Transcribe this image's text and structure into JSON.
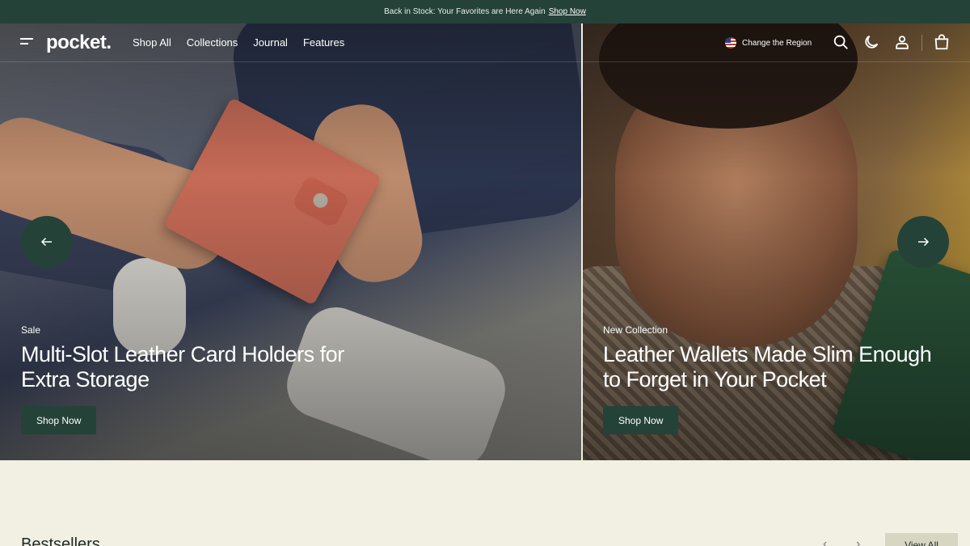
{
  "announcement": {
    "text": "Back in Stock: Your Favorites are Here Again",
    "link": "Shop Now"
  },
  "header": {
    "logo": "pocket.",
    "nav": [
      "Shop All",
      "Collections",
      "Journal",
      "Features"
    ],
    "region_label": "Change the Region",
    "icons": [
      "search-icon",
      "dark-mode-icon",
      "account-icon",
      "cart-icon"
    ]
  },
  "hero": {
    "slides": [
      {
        "tag": "Sale",
        "title": "Multi-Slot Leather Card Holders for Extra Storage",
        "button": "Shop Now"
      },
      {
        "tag": "New Collection",
        "title": "Leather Wallets Made Slim Enough to Forget in Your Pocket",
        "button": "Shop Now"
      }
    ]
  },
  "bestsellers": {
    "heading": "Bestsellers",
    "view_all": "View All"
  },
  "colors": {
    "accent": "#254238",
    "background": "#f2efe3",
    "button_secondary": "#d7d6c3"
  }
}
